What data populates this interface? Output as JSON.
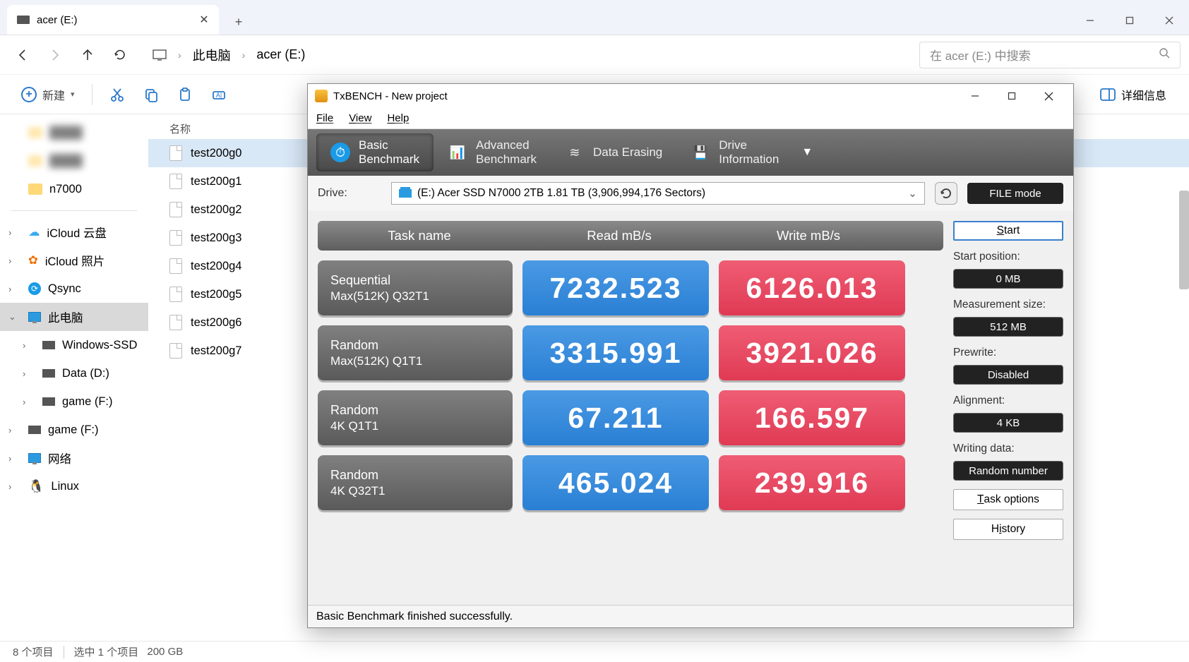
{
  "explorer": {
    "tab": {
      "title": "acer (E:)"
    },
    "breadcrumb": {
      "root": "此电脑",
      "current": "acer (E:)"
    },
    "search_placeholder": "在 acer (E:) 中搜索",
    "toolbar": {
      "new": "新建",
      "details": "详细信息"
    },
    "sidebar": {
      "quick": [
        "",
        "",
        "n7000"
      ],
      "items": [
        {
          "label": "iCloud 云盘"
        },
        {
          "label": "iCloud 照片"
        },
        {
          "label": "Qsync"
        },
        {
          "label": "此电脑",
          "active": true
        },
        {
          "label": "Windows-SSD",
          "lvl2": true
        },
        {
          "label": "Data (D:)",
          "lvl2": true
        },
        {
          "label": "game (F:)",
          "lvl2": true
        },
        {
          "label": "game (F:)"
        },
        {
          "label": "网络"
        },
        {
          "label": "Linux"
        }
      ]
    },
    "filelist": {
      "header": "名称",
      "files": [
        "test200g0",
        "test200g1",
        "test200g2",
        "test200g3",
        "test200g4",
        "test200g5",
        "test200g6",
        "test200g7"
      ],
      "selected": 0
    },
    "status": {
      "count": "8 个项目",
      "selected": "选中 1 个项目",
      "size": "200 GB"
    }
  },
  "txbench": {
    "title": "TxBENCH - New project",
    "menu": {
      "file": "File",
      "view": "View",
      "help": "Help"
    },
    "tabs": {
      "basic": {
        "l1": "Basic",
        "l2": "Benchmark"
      },
      "advanced": {
        "l1": "Advanced",
        "l2": "Benchmark"
      },
      "erasing": {
        "l1": "Data Erasing"
      },
      "drive": {
        "l1": "Drive",
        "l2": "Information"
      }
    },
    "drive_label": "Drive:",
    "drive_value": "(E:) Acer SSD N7000 2TB  1.81 TB (3,906,994,176 Sectors)",
    "file_mode": "FILE mode",
    "columns": {
      "task": "Task name",
      "read": "Read mB/s",
      "write": "Write mB/s"
    },
    "rows": [
      {
        "l1": "Sequential",
        "l2": "Max(512K) Q32T1",
        "read": "7232.523",
        "write": "6126.013"
      },
      {
        "l1": "Random",
        "l2": "Max(512K) Q1T1",
        "read": "3315.991",
        "write": "3921.026"
      },
      {
        "l1": "Random",
        "l2": "4K Q1T1",
        "read": "67.211",
        "write": "166.597"
      },
      {
        "l1": "Random",
        "l2": "4K Q32T1",
        "read": "465.024",
        "write": "239.916"
      }
    ],
    "side": {
      "start": "Start",
      "labels": {
        "startpos": "Start position:",
        "msize": "Measurement size:",
        "prewrite": "Prewrite:",
        "align": "Alignment:",
        "wdata": "Writing data:"
      },
      "vals": {
        "startpos": "0 MB",
        "msize": "512 MB",
        "prewrite": "Disabled",
        "align": "4 KB",
        "wdata": "Random number"
      },
      "task_options": "Task options",
      "history": "History"
    },
    "status": "Basic Benchmark finished successfully."
  }
}
